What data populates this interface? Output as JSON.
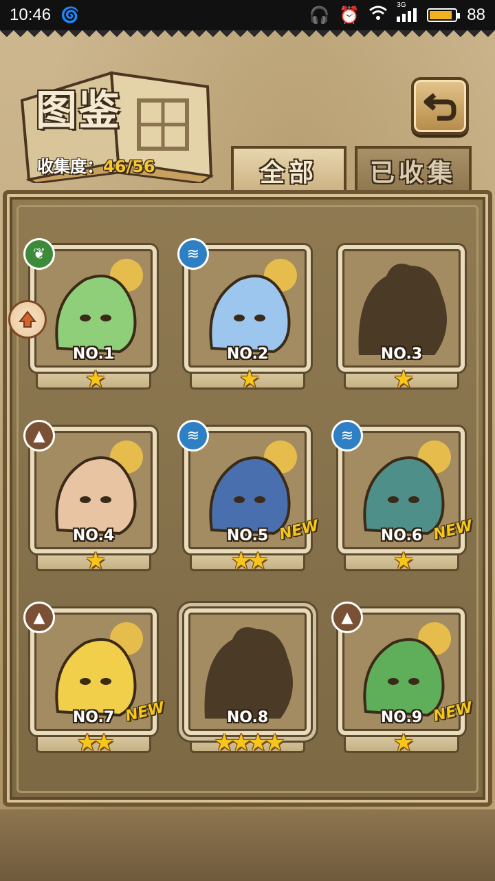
{
  "status_bar": {
    "time": "10:46",
    "battery_level": "88",
    "battery_fraction": 0.88,
    "network": "3G"
  },
  "header": {
    "title": "图鉴",
    "progress_label": "收集度：",
    "progress_value": "46/56"
  },
  "tabs": [
    {
      "label": "全部",
      "active": true
    },
    {
      "label": "已收集",
      "active": false
    }
  ],
  "cards": [
    {
      "number": "NO.1",
      "stars": "★",
      "element": "grass",
      "badge_icon": "leaf-icon",
      "is_new": false,
      "discovered": true,
      "color": "#8fcf7a"
    },
    {
      "number": "NO.2",
      "stars": "★",
      "element": "water",
      "badge_icon": "wave-icon",
      "is_new": false,
      "discovered": true,
      "color": "#9cc6ee"
    },
    {
      "number": "NO.3",
      "stars": "★",
      "element": "",
      "badge_icon": "",
      "is_new": false,
      "discovered": false,
      "color": "#4b3a26"
    },
    {
      "number": "NO.4",
      "stars": "★",
      "element": "earth",
      "badge_icon": "mountain-icon",
      "is_new": false,
      "discovered": true,
      "color": "#e8c4a2"
    },
    {
      "number": "NO.5",
      "stars": "★★",
      "element": "water",
      "badge_icon": "wave-icon",
      "is_new": true,
      "discovered": true,
      "color": "#4a6fae"
    },
    {
      "number": "NO.6",
      "stars": "★",
      "element": "water",
      "badge_icon": "wave-icon",
      "is_new": true,
      "discovered": true,
      "color": "#4f8f8a"
    },
    {
      "number": "NO.7",
      "stars": "★★",
      "element": "earth",
      "badge_icon": "mountain-icon",
      "is_new": true,
      "discovered": true,
      "color": "#f2cf4a"
    },
    {
      "number": "NO.8",
      "stars": "★★★★",
      "element": "",
      "badge_icon": "",
      "is_new": false,
      "discovered": false,
      "color": "#4b3a26"
    },
    {
      "number": "NO.9",
      "stars": "★",
      "element": "earth",
      "badge_icon": "mountain-icon",
      "is_new": true,
      "discovered": true,
      "color": "#5fae5a"
    }
  ],
  "new_label": "NEW"
}
